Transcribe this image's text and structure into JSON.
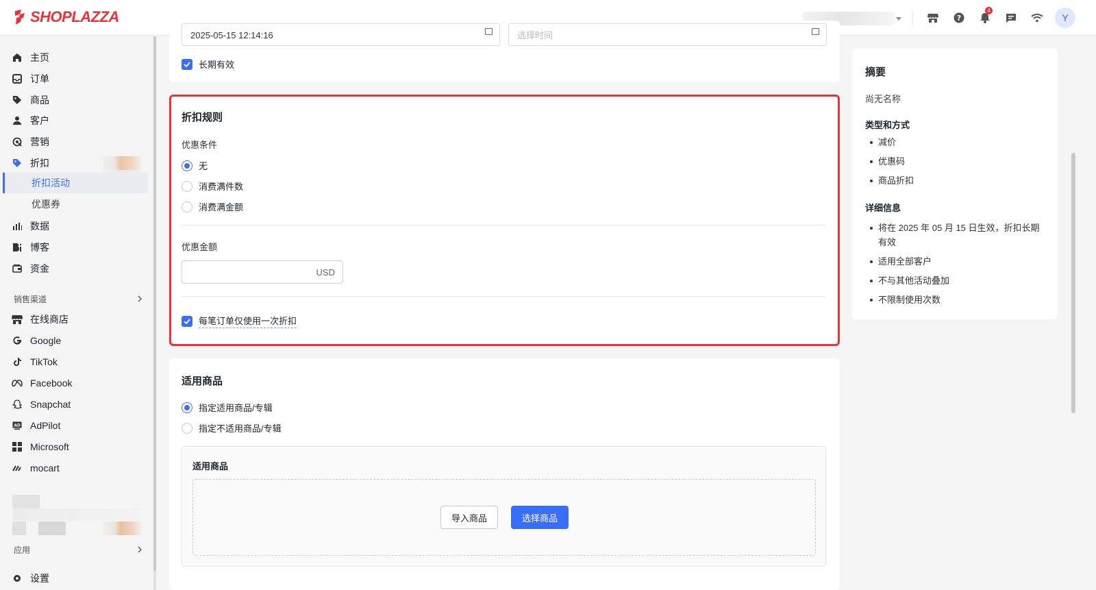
{
  "brand": {
    "name": "SHOPLAZZA",
    "color": "#e8333a"
  },
  "topbar": {
    "notification_count": "4",
    "avatar_letter": "Y",
    "icons": [
      "store-icon",
      "help-icon",
      "bell-icon",
      "chat-icon",
      "wifi-icon"
    ]
  },
  "sidebar": {
    "items": [
      {
        "label": "主页",
        "icon": "home-icon"
      },
      {
        "label": "订单",
        "icon": "inbox-icon"
      },
      {
        "label": "商品",
        "icon": "tag-icon"
      },
      {
        "label": "客户",
        "icon": "user-icon"
      },
      {
        "label": "营销",
        "icon": "marketing-icon"
      },
      {
        "label": "折扣",
        "icon": "discount-icon"
      },
      {
        "label": "数据",
        "icon": "chart-icon"
      },
      {
        "label": "博客",
        "icon": "blog-icon"
      },
      {
        "label": "资金",
        "icon": "wallet-icon"
      }
    ],
    "sub_items": [
      {
        "label": "折扣活动",
        "active": true
      },
      {
        "label": "优惠券",
        "active": false
      }
    ],
    "sales_channels_label": "销售渠道",
    "channels": [
      {
        "label": "在线商店",
        "icon": "store-icon"
      },
      {
        "label": "Google",
        "icon": "google-icon"
      },
      {
        "label": "TikTok",
        "icon": "tiktok-icon"
      },
      {
        "label": "Facebook",
        "icon": "meta-icon"
      },
      {
        "label": "Snapchat",
        "icon": "snapchat-icon"
      },
      {
        "label": "AdPilot",
        "icon": "adpilot-icon"
      },
      {
        "label": "Microsoft",
        "icon": "microsoft-icon"
      },
      {
        "label": "mocart",
        "icon": "mocart-icon"
      }
    ],
    "apps_label": "应用",
    "settings_label": "设置"
  },
  "date_card": {
    "start_value": "2025-05-15 12:14:16",
    "end_placeholder": "选择时间",
    "long_term_label": "长期有效",
    "long_term_checked": true
  },
  "discount_rules": {
    "title": "折扣规则",
    "condition_label": "优惠条件",
    "conditions": [
      {
        "label": "无",
        "selected": true
      },
      {
        "label": "消费满件数",
        "selected": false
      },
      {
        "label": "消费满金额",
        "selected": false
      }
    ],
    "amount_label": "优惠金额",
    "amount_value": "",
    "currency": "USD",
    "once_per_order_label": "每笔订单仅使用一次折扣",
    "once_per_order_checked": true
  },
  "applicable_products": {
    "title": "适用商品",
    "options": [
      {
        "label": "指定适用商品/专辑",
        "selected": true
      },
      {
        "label": "指定不适用商品/专辑",
        "selected": false
      }
    ],
    "panel_title": "适用商品",
    "import_button": "导入商品",
    "select_button": "选择商品"
  },
  "summary": {
    "title": "摘要",
    "name": "尚无名称",
    "type_heading": "类型和方式",
    "types": [
      "减价",
      "优惠码",
      "商品折扣"
    ],
    "details_heading": "详细信息",
    "details": [
      "将在 2025 年 05 月 15 日生效，折扣长期有效",
      "适用全部客户",
      "不与其他活动叠加",
      "不限制使用次数"
    ]
  },
  "colors": {
    "accent": "#3b6ef6",
    "highlight": "#e8333a"
  }
}
